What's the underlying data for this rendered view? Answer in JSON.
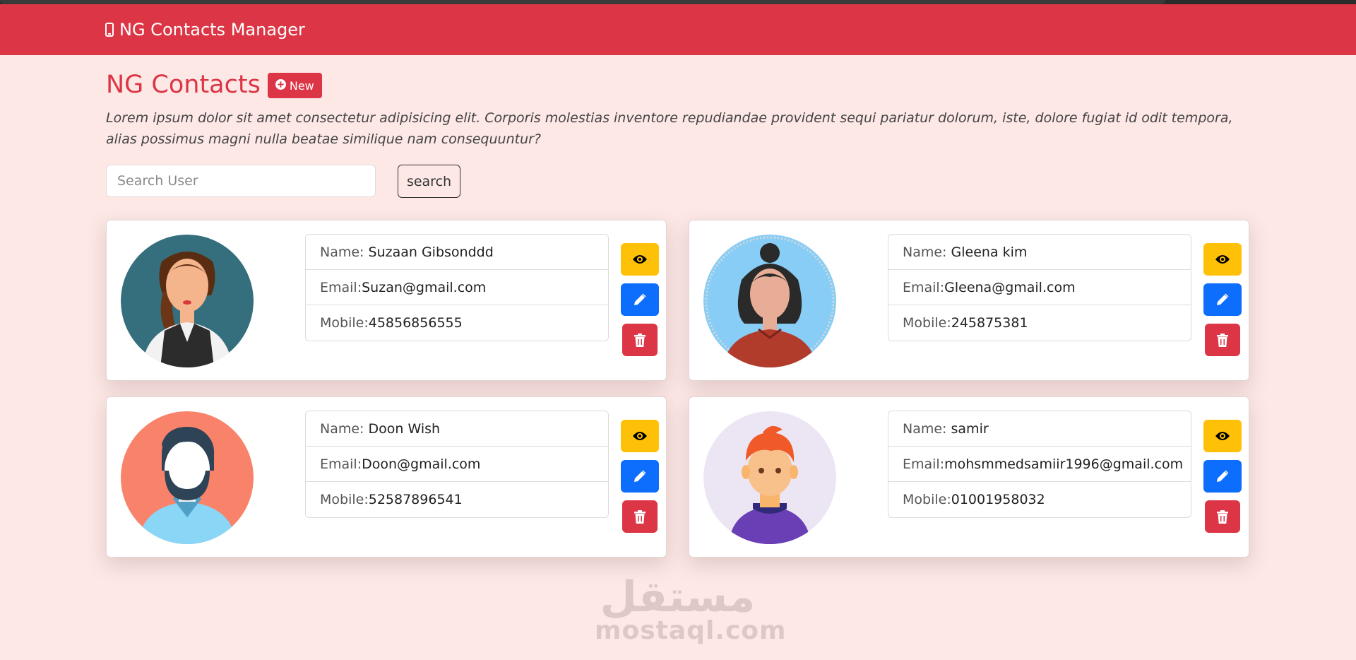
{
  "navbar": {
    "brand": "NG Contacts Manager",
    "brand_icon": "mobile-phone-icon",
    "color": "#dc3545"
  },
  "header": {
    "title": "NG Contacts",
    "new_button": "New",
    "description": "Lorem ipsum dolor sit amet consectetur adipisicing elit. Corporis molestias inventore repudiandae provident sequi pariatur dolorum, iste, dolore fugiat id odit tempora, alias possimus magni nulla beatae similique nam consequuntur?"
  },
  "search": {
    "placeholder": "Search User",
    "button": "search"
  },
  "labels": {
    "name": "Name:",
    "email": "Email:",
    "mobile": "Mobile:"
  },
  "contacts": [
    {
      "name": "Suzaan Gibsonddd",
      "email": "Suzan@gmail.com",
      "mobile": "45856856555",
      "avatar": "woman-avatar-icon"
    },
    {
      "name": "Gleena kim",
      "email": "Gleena@gmail.com",
      "mobile": "245875381",
      "avatar": "woman-bun-avatar-icon"
    },
    {
      "name": "Doon Wish",
      "email": "Doon@gmail.com",
      "mobile": "52587896541",
      "avatar": "bearded-man-avatar-icon"
    },
    {
      "name": "samir",
      "email": "mohsmmedsamiir1996@gmail.com",
      "mobile": "01001958032",
      "avatar": "boy-avatar-icon"
    }
  ],
  "actions": {
    "view_icon": "eye-icon",
    "edit_icon": "pencil-icon",
    "delete_icon": "trash-icon",
    "view_color": "#ffc107",
    "edit_color": "#0d6efd",
    "delete_color": "#dc3545"
  },
  "watermark": {
    "arabic": "مستقل",
    "latin": "mostaql.com"
  }
}
